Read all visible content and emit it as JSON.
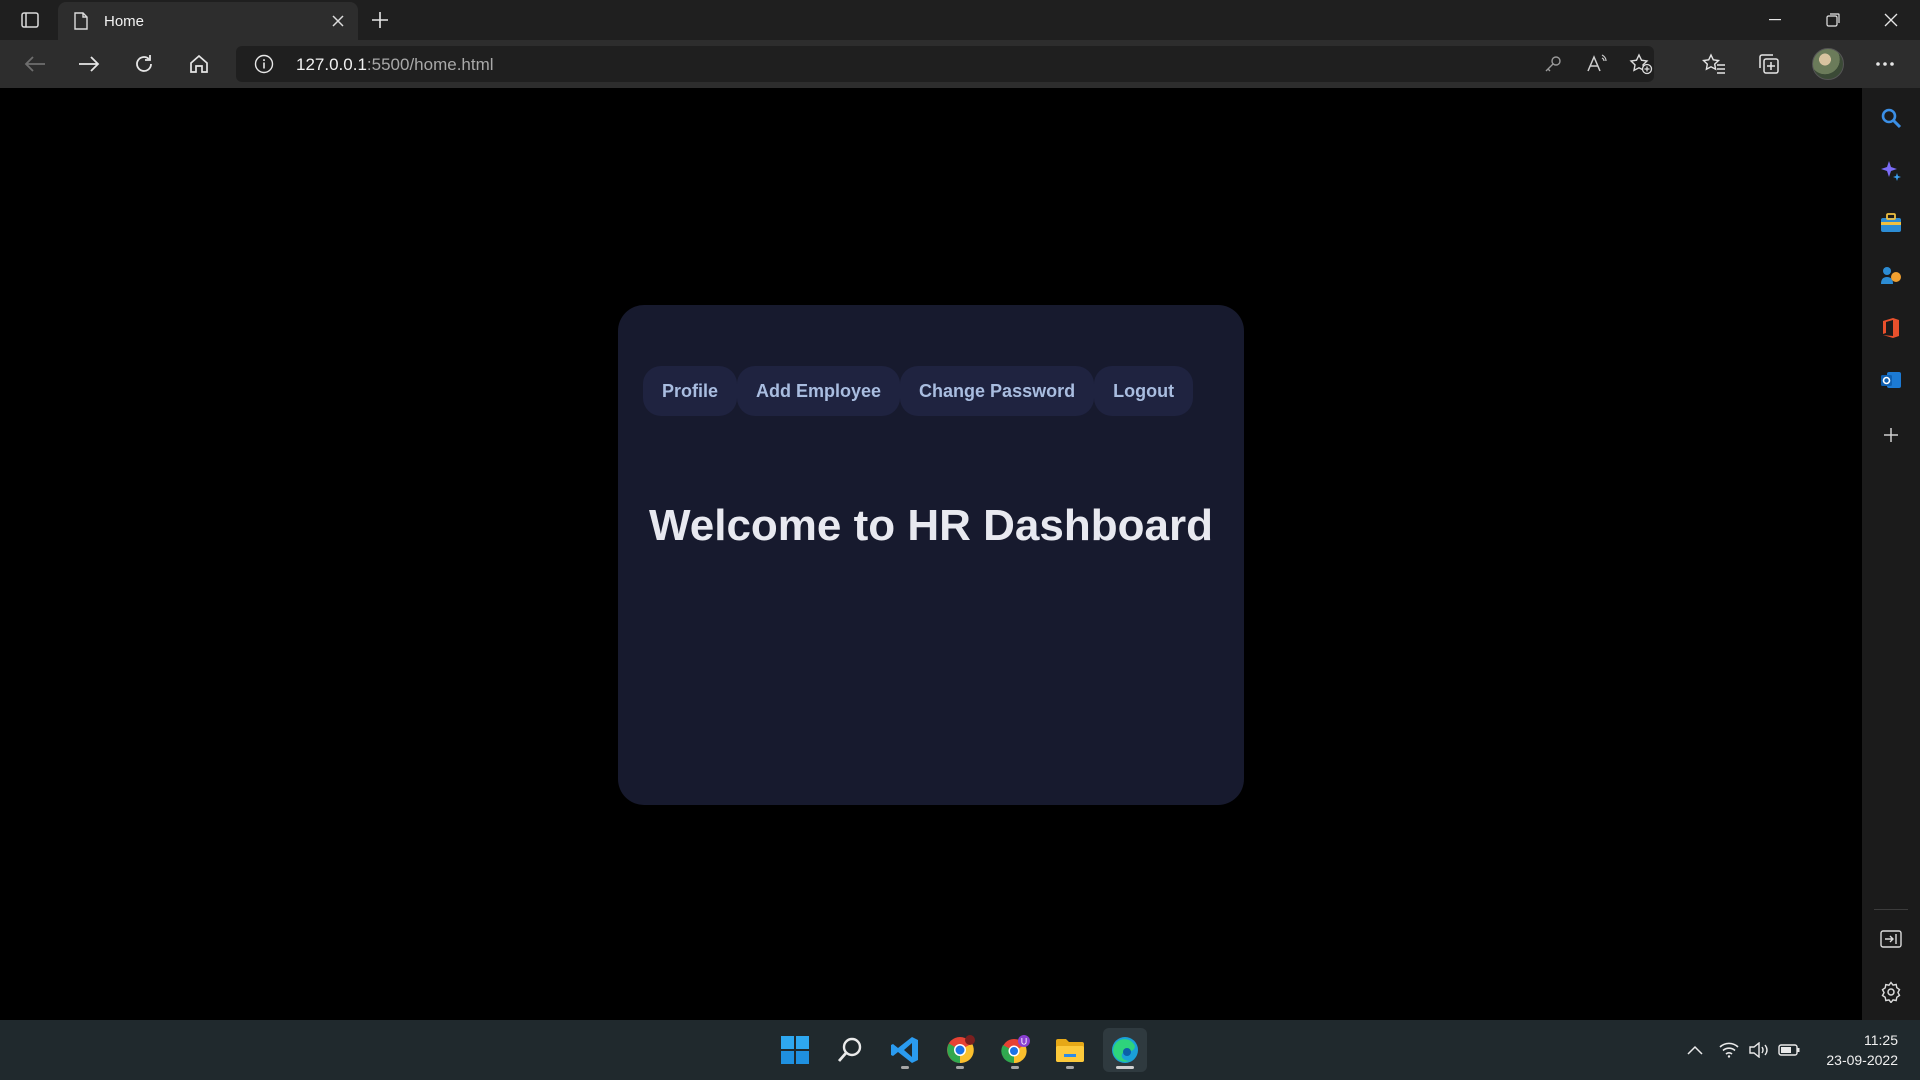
{
  "browser": {
    "tab_title": "Home",
    "url_host": "127.0.0.1",
    "url_rest": ":5500/home.html"
  },
  "page": {
    "nav": [
      {
        "label": "Profile"
      },
      {
        "label": "Add Employee"
      },
      {
        "label": "Change Password"
      },
      {
        "label": "Logout"
      }
    ],
    "heading": "Welcome to HR Dashboard"
  },
  "colors": {
    "page_background": "#000000",
    "card_background": "#171a2e",
    "nav_button_background": "#1f2340",
    "nav_button_text": "#a9bde0",
    "heading_text": "#e8e9f0"
  },
  "sidebar_icons": [
    "search-icon",
    "copilot-icon",
    "tools-icon",
    "games-icon",
    "office-icon",
    "outlook-icon",
    "add-icon",
    "hide-sidebar-icon",
    "settings-icon"
  ],
  "taskbar": {
    "apps": [
      "start-icon",
      "search-icon",
      "vscode-icon",
      "chrome-icon",
      "chrome-profile-icon",
      "file-explorer-icon",
      "edge-icon"
    ],
    "chrome_profile_badge": "U",
    "time": "11:25",
    "date": "23-09-2022"
  }
}
